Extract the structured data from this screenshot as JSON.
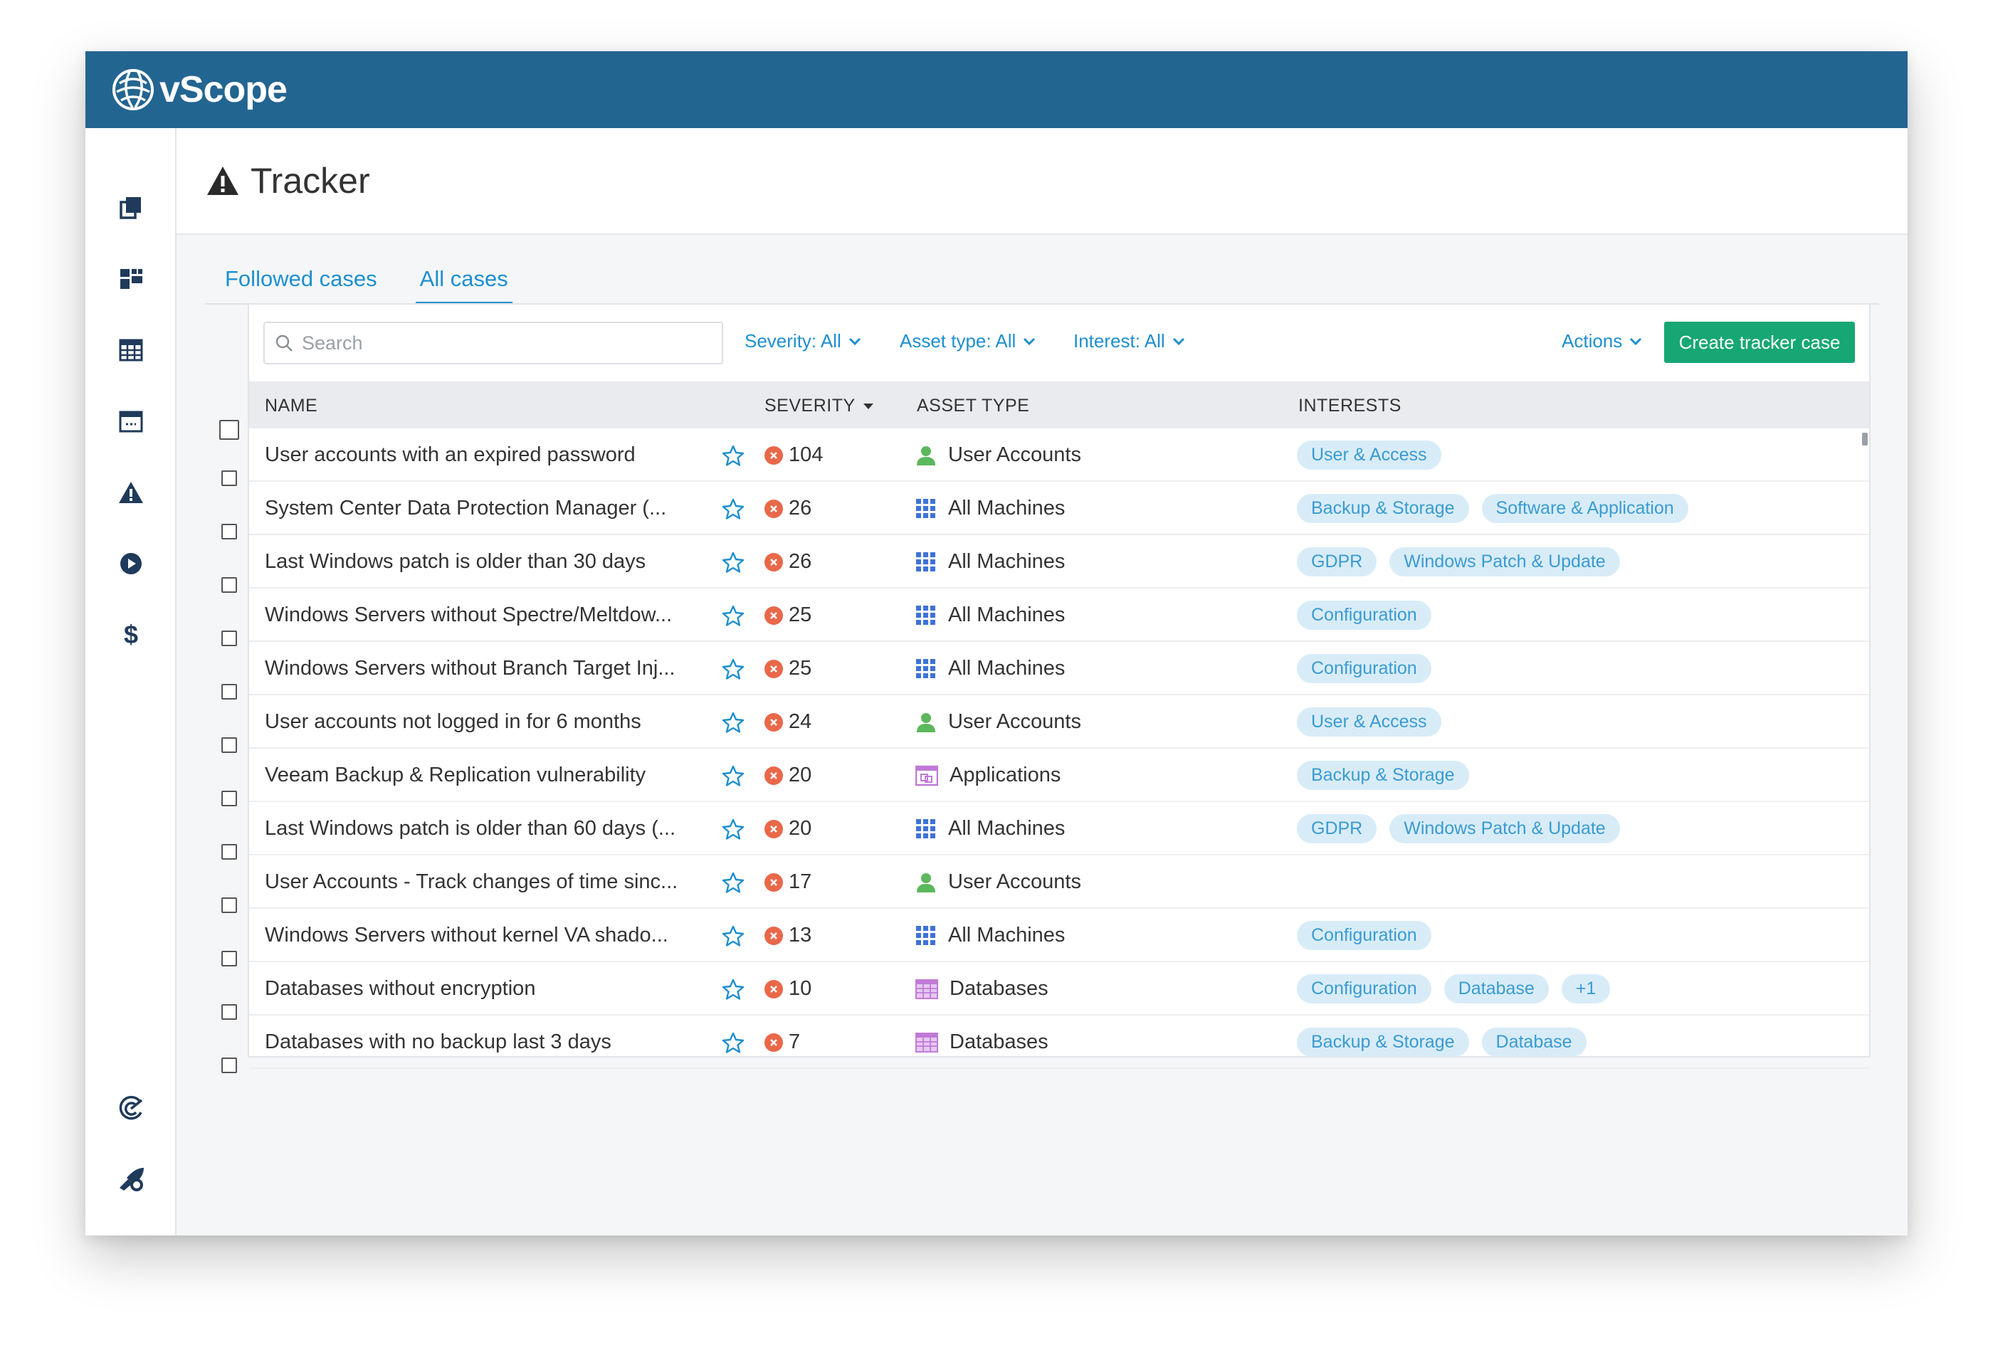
{
  "app": {
    "name": "vScope"
  },
  "page": {
    "title": "Tracker"
  },
  "tabs": [
    {
      "label": "Followed cases",
      "active": false
    },
    {
      "label": "All cases",
      "active": true
    }
  ],
  "toolbar": {
    "search_placeholder": "Search",
    "filters": {
      "severity": "Severity: All",
      "asset_type": "Asset type: All",
      "interest": "Interest: All"
    },
    "actions_label": "Actions",
    "create_label": "Create tracker case"
  },
  "table": {
    "headers": {
      "name": "NAME",
      "severity": "SEVERITY",
      "asset_type": "ASSET TYPE",
      "interests": "INTERESTS"
    },
    "rows": [
      {
        "name": "User accounts with an expired password",
        "severity": "104",
        "asset": "User Accounts",
        "asset_icon": "user-icon",
        "tags": [
          "User & Access"
        ]
      },
      {
        "name": "System Center Data Protection Manager (...",
        "severity": "26",
        "asset": "All Machines",
        "asset_icon": "grid-icon",
        "tags": [
          "Backup & Storage",
          "Software & Application"
        ]
      },
      {
        "name": "Last Windows patch is older than 30 days",
        "severity": "26",
        "asset": "All Machines",
        "asset_icon": "grid-icon",
        "tags": [
          "GDPR",
          "Windows Patch & Update"
        ]
      },
      {
        "name": "Windows Servers without Spectre/Meltdow...",
        "severity": "25",
        "asset": "All Machines",
        "asset_icon": "grid-icon",
        "tags": [
          "Configuration"
        ]
      },
      {
        "name": "Windows Servers without Branch Target Inj...",
        "severity": "25",
        "asset": "All Machines",
        "asset_icon": "grid-icon",
        "tags": [
          "Configuration"
        ]
      },
      {
        "name": "User accounts not logged in for 6 months",
        "severity": "24",
        "asset": "User Accounts",
        "asset_icon": "user-icon",
        "tags": [
          "User & Access"
        ]
      },
      {
        "name": "Veeam Backup & Replication vulnerability",
        "severity": "20",
        "asset": "Applications",
        "asset_icon": "app-icon",
        "tags": [
          "Backup & Storage"
        ]
      },
      {
        "name": "Last Windows patch is older than 60 days (...",
        "severity": "20",
        "asset": "All Machines",
        "asset_icon": "grid-icon",
        "tags": [
          "GDPR",
          "Windows Patch & Update"
        ]
      },
      {
        "name": "User Accounts - Track changes of time sinc...",
        "severity": "17",
        "asset": "User Accounts",
        "asset_icon": "user-icon",
        "tags": []
      },
      {
        "name": "Windows Servers without kernel VA shado...",
        "severity": "13",
        "asset": "All Machines",
        "asset_icon": "grid-icon",
        "tags": [
          "Configuration"
        ]
      },
      {
        "name": "Databases without encryption",
        "severity": "10",
        "asset": "Databases",
        "asset_icon": "database-icon",
        "tags": [
          "Configuration",
          "Database",
          "+1"
        ]
      },
      {
        "name": "Databases with no backup last 3 days",
        "severity": "7",
        "asset": "Databases",
        "asset_icon": "database-icon",
        "tags": [
          "Backup & Storage",
          "Database"
        ]
      }
    ]
  },
  "colors": {
    "topbar": "#236591",
    "accent": "#1d8fcf",
    "create_button": "#16a774",
    "severity": "#e9684a",
    "tag_bg": "#d8ecf8",
    "tag_text": "#3a9bd2"
  }
}
